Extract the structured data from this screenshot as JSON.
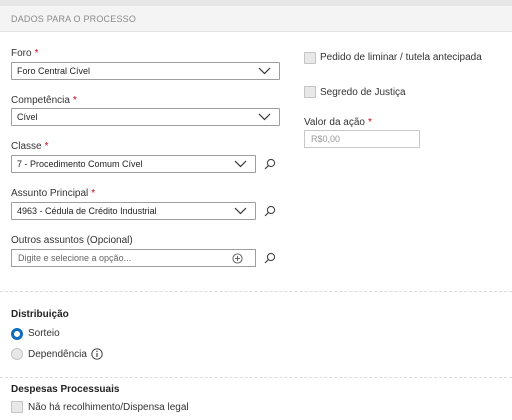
{
  "section": {
    "title": "DADOS PARA O PROCESSO"
  },
  "foro": {
    "label": "Foro",
    "required": "*",
    "value": "Foro Central Cível"
  },
  "competencia": {
    "label": "Competência",
    "required": "*",
    "value": "Cível"
  },
  "classe": {
    "label": "Classe",
    "required": "*",
    "value": "7 - Procedimento Comum Cível"
  },
  "assunto": {
    "label": "Assunto Principal",
    "required": "*",
    "value": "4963 - Cédula de Crédito Industrial"
  },
  "outros": {
    "label": "Outros assuntos (Opcional)",
    "placeholder": "Digite e selecione a opção..."
  },
  "options": {
    "liminar": "Pedido de liminar / tutela antecipada",
    "segredo": "Segredo de Justiça"
  },
  "valor": {
    "label": "Valor da ação",
    "required": "*",
    "placeholder": "R$0,00"
  },
  "distribuicao": {
    "title": "Distribuição",
    "options": [
      {
        "label": "Sorteio",
        "selected": true
      },
      {
        "label": "Dependência",
        "selected": false
      }
    ]
  },
  "despesas": {
    "title": "Despesas Processuais",
    "option": "Não há recolhimento/Dispensa legal"
  },
  "colors": {
    "accent": "#0f6cbd",
    "required": "#d0021b",
    "border": "#9e9e9e"
  }
}
